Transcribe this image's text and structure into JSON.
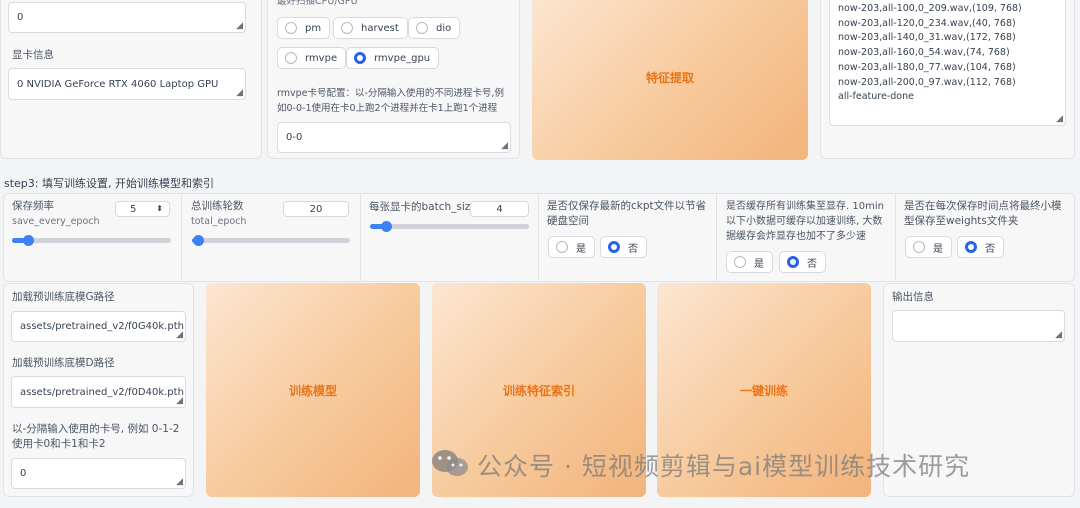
{
  "top": {
    "process_count_value": "0",
    "gpu_info_label": "显卡信息",
    "gpu_info_value": "0 NVIDIA GeForce RTX 4060 Laptop GPU",
    "f0_method_label": "最好в用CPU/GPU",
    "f0_options": [
      "pm",
      "harvest",
      "dio",
      "rmvpe",
      "rmvpe_gpu"
    ],
    "f0_selected": "rmvpe_gpu",
    "rmvpe_gpu_label": "rmvpe卡号配置：以-分隔输入使用的不同进程卡号,例如0-0-1使用在卡0上跑2个进程并在卡1上跑1个进程",
    "rmvpe_gpu_value": "0-0",
    "feature_button": "特征提取",
    "log_lines": [
      "now-203,all-100,0_209.wav,(109, 768)",
      "now-203,all-120,0_234.wav,(40, 768)",
      "now-203,all-140,0_31.wav,(172, 768)",
      "now-203,all-160,0_54.wav,(74, 768)",
      "now-203,all-180,0_77.wav,(104, 768)",
      "now-203,all-200,0_97.wav,(112, 768)",
      "all-feature-done"
    ]
  },
  "step3": {
    "title": "step3: 填写训练设置, 开始训练模型和索引",
    "save_freq_label": "保存频率",
    "save_freq_sub": "save_every_epoch",
    "save_freq_value": "5",
    "save_freq_fraction": 0.08,
    "total_epoch_label": "总训练轮数",
    "total_epoch_sub": "total_epoch",
    "total_epoch_value": "20",
    "total_epoch_fraction": 0.02,
    "batch_label": "每张显卡的batch_size",
    "batch_value": "4",
    "batch_fraction": 0.08,
    "latest_ckpt_label": "是否仅保存最新的ckpt文件以节省硬盘空间",
    "cache_label": "是否缓存所有训练集至显存. 10min以下小数据可缓存以加速训练, 大数据缓存会炸显存也加不了多少速",
    "save_small_label": "是否在每次保存时间点将最终小模型保存至weights文件夹",
    "yes": "是",
    "no": "否"
  },
  "bottom": {
    "g_path_label": "加载预训练底模G路径",
    "g_path_value": "assets/pretrained_v2/f0G40k.pth",
    "d_path_label": "加载预训练底模D路径",
    "d_path_value": "assets/pretrained_v2/f0D40k.pth",
    "gpus_label": "以-分隔输入使用的卡号, 例如 0-1-2 使用卡0和卡1和卡2",
    "gpus_value": "0",
    "train_model_button": "训练模型",
    "train_index_button": "训练特征索引",
    "one_click_button": "一键训练",
    "output_label": "输出信息",
    "output_value": ""
  },
  "watermark": "公众号 · 短视频剪辑与ai模型训练技术研究"
}
